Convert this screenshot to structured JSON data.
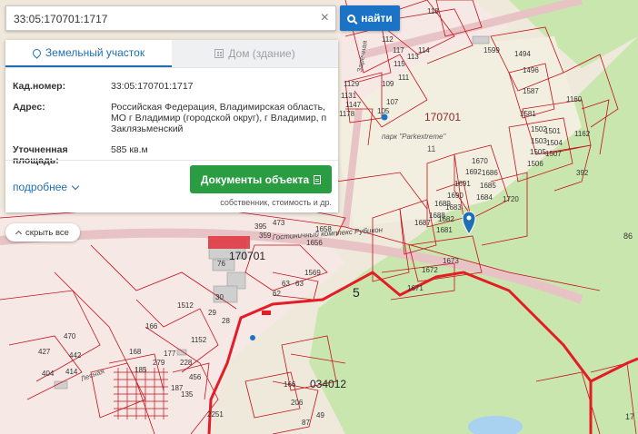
{
  "search": {
    "value": "33:05:170701:1717",
    "clear_label": "×"
  },
  "find_button": {
    "label": "найти"
  },
  "card": {
    "tabs": [
      {
        "label": "Земельный участок"
      },
      {
        "label": "Дом (здание)"
      }
    ],
    "fields": [
      {
        "label": "Кад.номер:",
        "value": "33:05:170701:1717"
      },
      {
        "label": "Адрес:",
        "value": "Российская Федерация, Владимирская область, МО г Владимир (городской округ), г Владимир, п Заклязьменский"
      },
      {
        "label": "Уточненная площадь:",
        "value": "585 кв.м"
      }
    ],
    "more_label": "подробнее",
    "docs_button_label": "Документы объекта",
    "docs_subtitle": "собственник, стоимость и др."
  },
  "hide_all_label": "скрыть все",
  "map": {
    "labels": {
      "quarter_main": "170701",
      "quarter_left": "170701",
      "quarter_bottom": "034012",
      "park": "парк \"Parkextreme\"",
      "complex": "Гостиничный комплекс Рубикон",
      "zone_5": "5",
      "street": "Заречная",
      "street_lesnaya": "Лесная",
      "n11": "11",
      "n86": "86",
      "n17": "17"
    },
    "parcels": [
      "1599",
      "1494",
      "1496",
      "1581",
      "1587",
      "1502",
      "1501",
      "1503",
      "1504",
      "1505",
      "1506",
      "1507",
      "1162",
      "1160",
      "392",
      "1670",
      "1686",
      "1692",
      "1685",
      "1691",
      "1684",
      "1690",
      "1683",
      "1689",
      "1682",
      "1688",
      "1681",
      "1687",
      "1720",
      "1671",
      "1672",
      "1673",
      "1656",
      "1658",
      "1569",
      "63",
      "62",
      "76",
      "30",
      "29",
      "28",
      "473",
      "359",
      "395",
      "117",
      "115",
      "113",
      "114",
      "118",
      "112",
      "111",
      "109",
      "107",
      "105",
      "1129",
      "1131",
      "1147",
      "1178",
      "1512",
      "1152",
      "166",
      "168",
      "185",
      "279",
      "404",
      "414",
      "442",
      "427",
      "470",
      "228",
      "456",
      "187",
      "135",
      "2251",
      "177",
      "166",
      "206",
      "49",
      "87"
    ]
  },
  "colors": {
    "primary_blue": "#1a73c4",
    "green_button": "#2a9d43",
    "parcel_line": "#c4121b",
    "zone_line": "#e41c25",
    "forest": "#c8e6ae",
    "map_bg": "#efe9dc",
    "road": "#e8c3c5"
  }
}
